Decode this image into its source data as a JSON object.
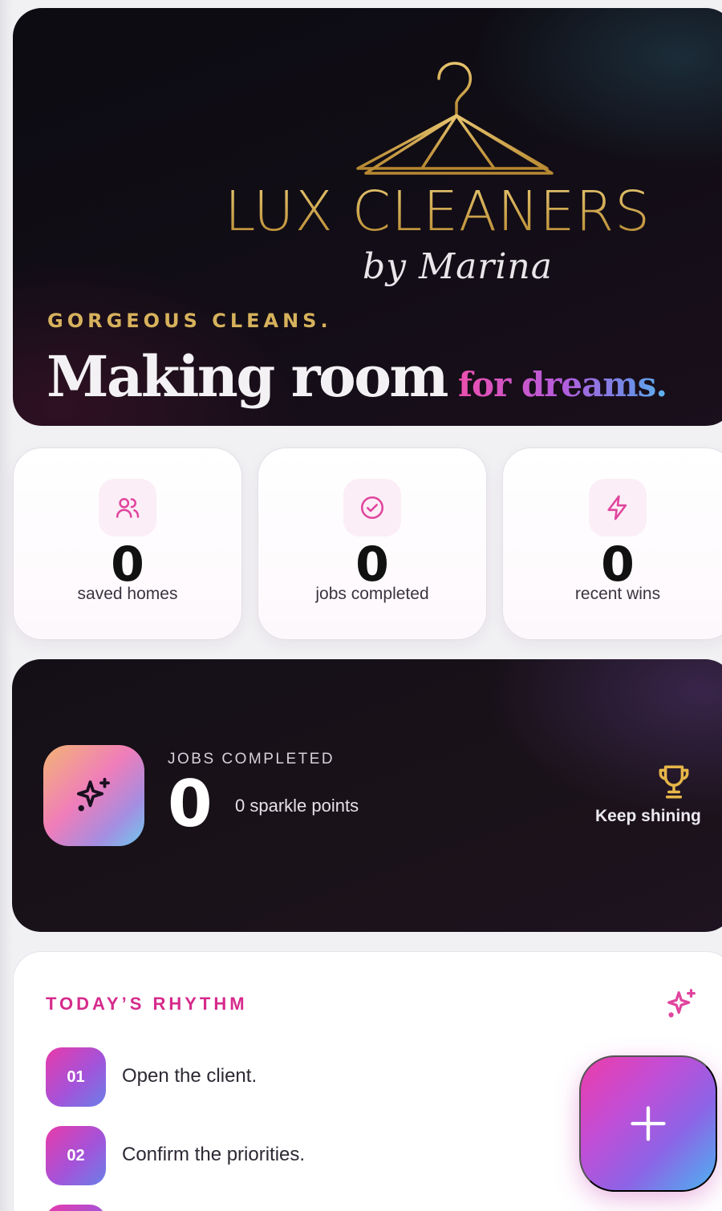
{
  "colors": {
    "gold": "#caa24c",
    "pink": "#d62b8c",
    "hero_bg": "#0c0c12",
    "card_bg": "#ffffff",
    "fab_gradient_start": "#ec3ca9",
    "fab_gradient_end": "#4cb3ef"
  },
  "hero": {
    "logo_icon": "hanger-icon",
    "brand_name": "LUX CLEANERS",
    "brand_sub": "by Marina",
    "eyebrow": "GORGEOUS CLEANS.",
    "headline_main": "Making room",
    "headline_accent": "for dreams."
  },
  "stats": [
    {
      "icon": "users-icon",
      "value": "0",
      "label": "saved homes"
    },
    {
      "icon": "check-circle-icon",
      "value": "0",
      "label": "jobs completed"
    },
    {
      "icon": "lightning-icon",
      "value": "0",
      "label": "recent wins"
    }
  ],
  "jobs_panel": {
    "icon": "sparkles-icon",
    "eyebrow": "JOBS COMPLETED",
    "value": "0",
    "points": "0 sparkle points",
    "trophy_icon": "trophy-icon",
    "status": "Keep shining"
  },
  "rhythm": {
    "title": "TODAY’S RHYTHM",
    "icon": "sparkles-icon",
    "steps": [
      {
        "num": "01",
        "text": "Open the client."
      },
      {
        "num": "02",
        "text": "Confirm the priorities."
      }
    ]
  },
  "fab": {
    "icon": "plus-icon"
  }
}
